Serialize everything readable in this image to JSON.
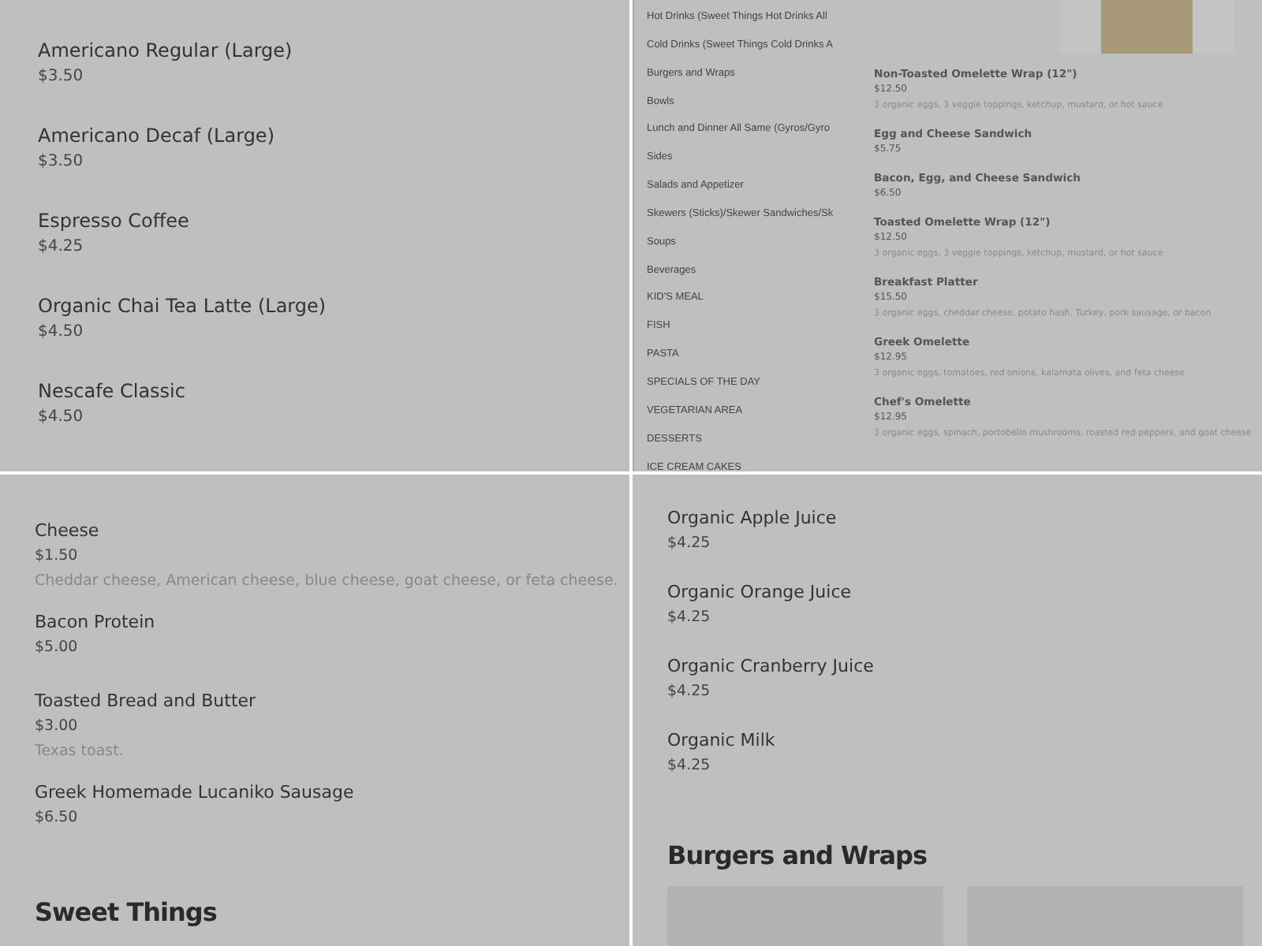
{
  "drinks_panel": {
    "items": [
      {
        "name": "Americano Regular (Large)",
        "price": "$3.50"
      },
      {
        "name": "Americano Decaf (Large)",
        "price": "$3.50"
      },
      {
        "name": "Espresso Coffee",
        "price": "$4.25"
      },
      {
        "name": "Organic Chai Tea Latte (Large)",
        "price": "$4.50"
      },
      {
        "name": "Nescafe Classic",
        "price": "$4.50"
      }
    ]
  },
  "category_panel": {
    "sidebar": {
      "items": [
        "Hot Drinks (Sweet Things Hot Drinks All",
        "Cold Drinks (Sweet Things Cold Drinks A",
        "Burgers and Wraps",
        "Bowls",
        "Lunch and Dinner All Same (Gyros/Gyro",
        "Sides",
        "Salads and Appetizer",
        "Skewers (Sticks)/Skewer Sandwiches/Sk",
        "Soups",
        "Beverages",
        "KID'S MEAL",
        "FISH",
        "PASTA",
        "SPECIALS OF THE DAY",
        "VEGETARIAN AREA",
        "DESSERTS",
        "ICE CREAM CAKES"
      ]
    },
    "items": [
      {
        "name": "Non-Toasted Omelette Wrap (12\")",
        "price": "$12.50",
        "description": "3 organic eggs, 3 veggie toppings, ketchup, mustard, or hot sauce"
      },
      {
        "name": "Egg and Cheese Sandwich",
        "price": "$5.75"
      },
      {
        "name": "Bacon, Egg, and Cheese Sandwich",
        "price": "$6.50"
      },
      {
        "name": "Toasted Omelette Wrap (12\")",
        "price": "$12.50",
        "description": "3 organic eggs, 3 veggie toppings, ketchup, mustard, or hot sauce"
      },
      {
        "name": "Breakfast Platter",
        "price": "$15.50",
        "description": "3 organic eggs, cheddar cheese, potato hash. Turkey, pork sausage, or bacon"
      },
      {
        "name": "Greek Omelette",
        "price": "$12.95",
        "description": "3 organic eggs, tomatoes, red onions, kalamata olives, and feta cheese"
      },
      {
        "name": "Chef's Omelette",
        "price": "$12.95",
        "description": "3 organic eggs, spinach, portobello mushrooms, roasted red peppers, and goat cheese"
      }
    ]
  },
  "extras_panel": {
    "items": [
      {
        "name": "Cheese",
        "price": "$1.50",
        "description": "Cheddar cheese, American cheese, blue cheese, goat cheese, or feta cheese."
      },
      {
        "name": "Bacon Protein",
        "price": "$5.00"
      },
      {
        "name": "Toasted Bread and Butter",
        "price": "$3.00",
        "description": "Texas toast."
      },
      {
        "name": "Greek Homemade Lucaniko Sausage",
        "price": "$6.50"
      }
    ],
    "heading": "Sweet Things"
  },
  "juice_panel": {
    "items": [
      {
        "name": "Organic Apple Juice",
        "price": "$4.25"
      },
      {
        "name": "Organic Orange Juice",
        "price": "$4.25"
      },
      {
        "name": "Organic Cranberry Juice",
        "price": "$4.25"
      },
      {
        "name": "Organic Milk",
        "price": "$4.25"
      }
    ],
    "heading": "Burgers and Wraps"
  }
}
